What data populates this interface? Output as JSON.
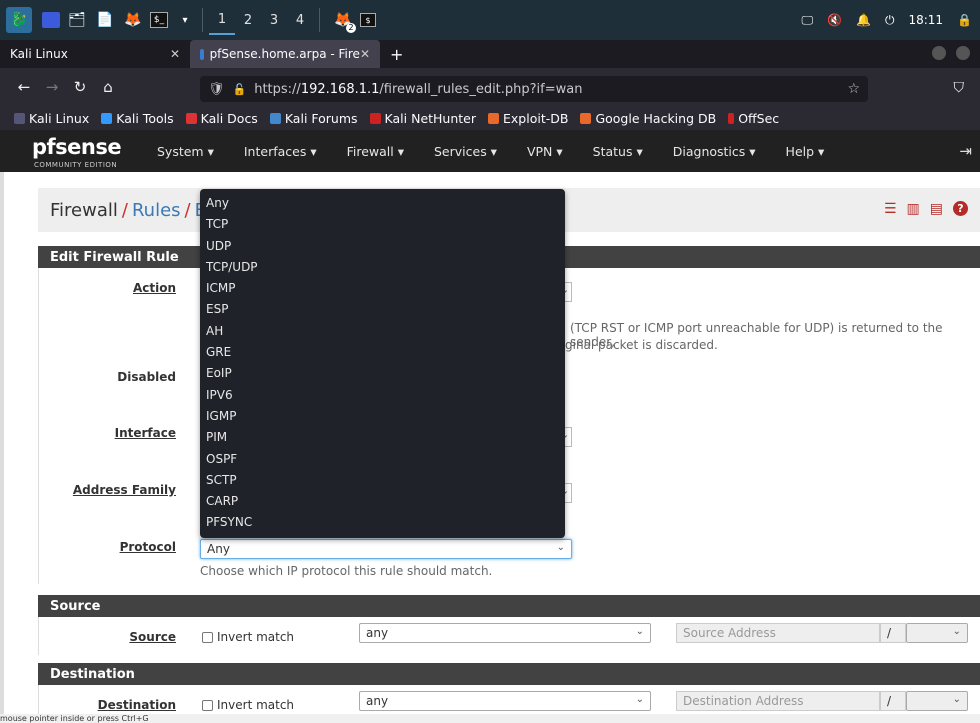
{
  "taskbar": {
    "workspaces": [
      "1",
      "2",
      "3",
      "4"
    ],
    "clock": "18:11",
    "notification_badge": "2"
  },
  "tabs": [
    {
      "title": "Kali Linux"
    },
    {
      "title": "pfSense.home.arpa - Fire"
    }
  ],
  "url": {
    "prefix": "https://",
    "host": "192.168.1.1",
    "path": "/firewall_rules_edit.php?if=wan"
  },
  "bookmarks": [
    "Kali Linux",
    "Kali Tools",
    "Kali Docs",
    "Kali Forums",
    "Kali NetHunter",
    "Exploit-DB",
    "Google Hacking DB",
    "OffSec"
  ],
  "pfsense": {
    "logo_word": "pfsense",
    "logo_sub": "COMMUNITY EDITION",
    "menu": [
      "System ▾",
      "Interfaces ▾",
      "Firewall ▾",
      "Services ▾",
      "VPN ▾",
      "Status ▾",
      "Diagnostics ▾",
      "Help ▾"
    ]
  },
  "breadcrumb": {
    "part1": "Firewall",
    "sep": "/",
    "part2": "Rules",
    "part3": "E"
  },
  "edit_section": {
    "title": "Edit Firewall Rule",
    "action_label": "Action",
    "action_help_line1": "(TCP RST or ICMP port unreachable for UDP) is returned to the sender,",
    "action_help_line2": "ginal packet is discarded.",
    "disabled_label": "Disabled",
    "interface_label": "Interface",
    "address_family_label": "Address Family",
    "protocol_label": "Protocol",
    "protocol_value": "Any",
    "protocol_help": "Choose which IP protocol this rule should match."
  },
  "protocol_options": [
    "Any",
    "TCP",
    "UDP",
    "TCP/UDP",
    "ICMP",
    "ESP",
    "AH",
    "GRE",
    "EoIP",
    "IPV6",
    "IGMP",
    "PIM",
    "OSPF",
    "SCTP",
    "CARP",
    "PFSYNC"
  ],
  "source_section": {
    "title": "Source",
    "label": "Source",
    "invert_label": "Invert match",
    "type_value": "any",
    "address_placeholder": "Source Address",
    "slash": "/"
  },
  "destination_section": {
    "title": "Destination",
    "label": "Destination",
    "invert_label": "Invert match",
    "type_value": "any",
    "address_placeholder": "Destination Address",
    "slash": "/"
  },
  "statusbar": {
    "text": "mouse pointer inside or press Ctrl+G"
  }
}
